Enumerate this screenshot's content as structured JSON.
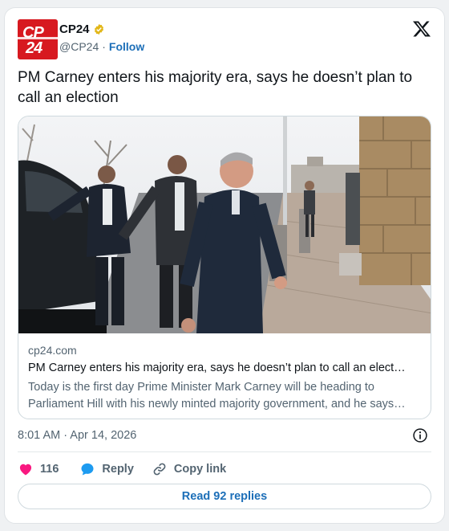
{
  "account": {
    "display_name": "CP24",
    "handle": "@CP24",
    "separator": "·",
    "follow_label": "Follow",
    "avatar_text_top": "CP",
    "avatar_text_bottom": "24",
    "avatar_color": "#d71920",
    "verified_badge_color": "#e2b719"
  },
  "tweet": {
    "text": "PM Carney enters his majority era, says he doesn’t plan to call an election"
  },
  "link_card": {
    "domain": "cp24.com",
    "title": "PM Carney enters his majority era, says he doesn’t plan to call an elect…",
    "description": "Today is the first day Prime Minister Mark Carney will be heading to Parliament Hill with his newly minted majority government, and he says…"
  },
  "meta": {
    "timestamp": "8:01 AM · Apr 14, 2026"
  },
  "actions": {
    "like_count": "116",
    "reply_label": "Reply",
    "copy_label": "Copy link",
    "like_color": "#f91880",
    "reply_color": "#1d9bf0"
  },
  "footer": {
    "read_replies_label": "Read 92 replies"
  },
  "icons": [
    "verified-badge-icon",
    "x-logo-icon",
    "info-icon",
    "heart-icon",
    "reply-bubble-icon",
    "link-icon"
  ]
}
